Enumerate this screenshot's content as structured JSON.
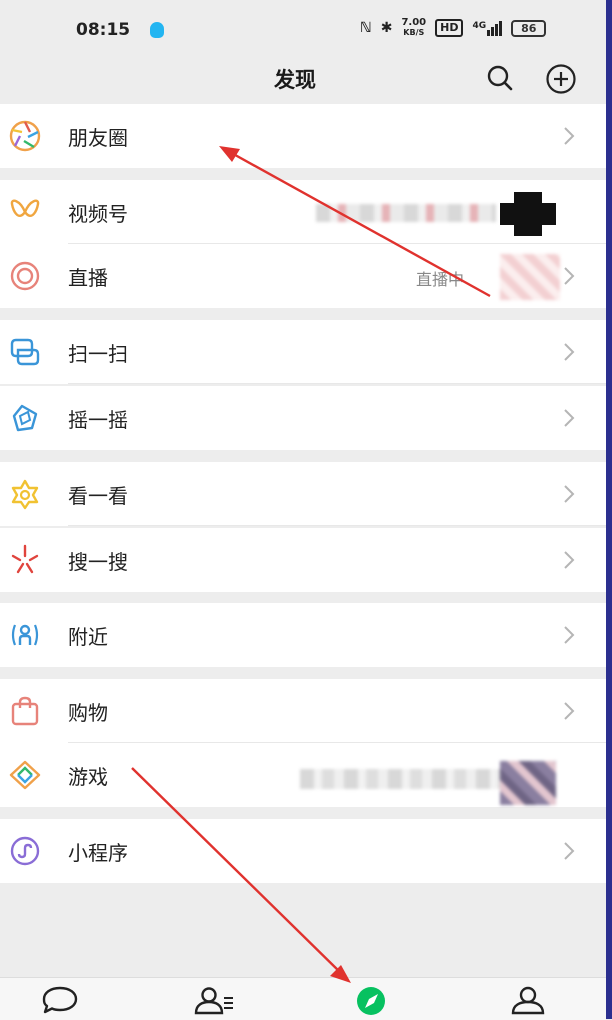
{
  "status_bar": {
    "time": "08:15",
    "net_speed_value": "7.00",
    "net_speed_unit": "KB/S",
    "hd": "HD",
    "signal": "4G",
    "battery": "86"
  },
  "header": {
    "title": "发现",
    "search_icon": "search-icon",
    "add_icon": "plus-circle-icon"
  },
  "menu": {
    "moments": {
      "label": "朋友圈",
      "icon": "moments-aperture-icon"
    },
    "channels": {
      "label": "视频号",
      "icon": "channels-butterfly-icon"
    },
    "live": {
      "label": "直播",
      "icon": "live-rings-icon",
      "status": "直播中"
    },
    "scan": {
      "label": "扫一扫",
      "icon": "scan-icon"
    },
    "shake": {
      "label": "摇一摇",
      "icon": "shake-icon"
    },
    "top_stories": {
      "label": "看一看",
      "icon": "top-stories-icon"
    },
    "search": {
      "label": "搜一搜",
      "icon": "search-star-icon"
    },
    "nearby": {
      "label": "附近",
      "icon": "nearby-icon"
    },
    "shopping": {
      "label": "购物",
      "icon": "shopping-bag-icon"
    },
    "games": {
      "label": "游戏",
      "icon": "games-diamond-icon"
    },
    "mini_programs": {
      "label": "小程序",
      "icon": "mini-programs-icon"
    }
  },
  "bottom_nav": {
    "chats_icon": "chat-bubble-icon",
    "contacts_icon": "contacts-icon",
    "discover_icon": "discover-compass-icon",
    "me_icon": "me-person-icon"
  },
  "colors": {
    "accent_green": "#07c160",
    "annotation_red": "#e0322e",
    "background": "#ededed"
  }
}
